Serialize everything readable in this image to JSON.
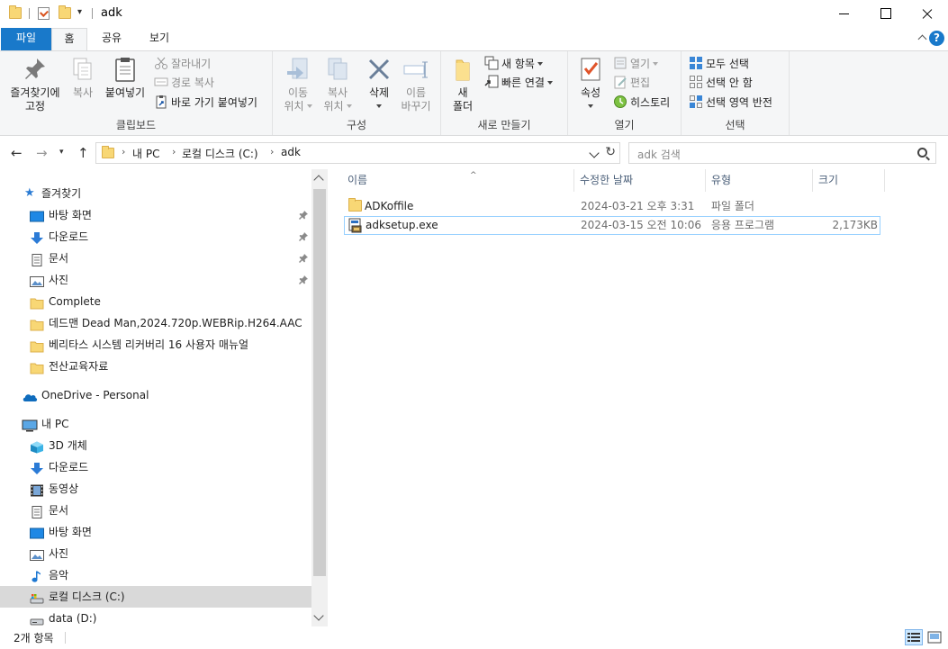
{
  "window": {
    "title": "adk",
    "qa_dropdown": "▾"
  },
  "ribbon_tabs": [
    {
      "label": "파일"
    },
    {
      "label": "홈"
    },
    {
      "label": "공유"
    },
    {
      "label": "보기"
    }
  ],
  "ribbon": {
    "clipboard": {
      "label": "클립보드",
      "pin": "즐겨찾기에\n고정",
      "copy": "복사",
      "paste": "붙여넣기",
      "cut": "잘라내기",
      "copy_path": "경로 복사",
      "paste_shortcut": "바로 가기 붙여넣기"
    },
    "organize": {
      "label": "구성",
      "move_to": "이동\n위치",
      "copy_to": "복사\n위치",
      "delete": "삭제",
      "rename": "이름\n바꾸기"
    },
    "new": {
      "label": "새로 만들기",
      "new_folder": "새\n폴더",
      "new_item": "새 항목",
      "easy_access": "빠른 연결"
    },
    "open": {
      "label": "열기",
      "properties": "속성",
      "open": "열기",
      "edit": "편집",
      "history": "히스토리"
    },
    "select": {
      "label": "선택",
      "select_all": "모두 선택",
      "select_none": "선택 안 함",
      "invert": "선택 영역 반전"
    }
  },
  "address": {
    "crumbs": [
      "내 PC",
      "로컬 디스크 (C:)",
      "adk"
    ],
    "sep": "›",
    "search_placeholder": "adk 검색"
  },
  "nav": {
    "quick_access": "즐겨찾기",
    "items": [
      {
        "label": "바탕 화면",
        "icon": "desktop-icon",
        "pinned": true
      },
      {
        "label": "다운로드",
        "icon": "download-icon",
        "pinned": true
      },
      {
        "label": "문서",
        "icon": "document-icon",
        "pinned": true
      },
      {
        "label": "사진",
        "icon": "pictures-icon",
        "pinned": true
      },
      {
        "label": "Complete",
        "icon": "folder-icon"
      },
      {
        "label": "데드맨 Dead Man,2024.720p.WEBRip.H264.AAC",
        "icon": "folder-icon"
      },
      {
        "label": "베리타스 시스템 리커버리 16 사용자 매뉴얼",
        "icon": "folder-icon"
      },
      {
        "label": "전산교육자료",
        "icon": "folder-icon"
      }
    ],
    "onedrive": "OneDrive - Personal",
    "this_pc": "내 PC",
    "pc_items": [
      {
        "label": "3D 개체",
        "icon": "3d-objects-icon"
      },
      {
        "label": "다운로드",
        "icon": "download-icon"
      },
      {
        "label": "동영상",
        "icon": "videos-icon"
      },
      {
        "label": "문서",
        "icon": "document-icon"
      },
      {
        "label": "바탕 화면",
        "icon": "desktop-icon"
      },
      {
        "label": "사진",
        "icon": "pictures-icon"
      },
      {
        "label": "음악",
        "icon": "music-icon"
      },
      {
        "label": "로컬 디스크 (C:)",
        "icon": "local-disk-icon",
        "selected": true
      },
      {
        "label": "data (D:)",
        "icon": "drive-icon"
      }
    ]
  },
  "columns": {
    "name": "이름",
    "date": "수정한 날짜",
    "type": "유형",
    "size": "크기"
  },
  "files": [
    {
      "name": "ADKoffile",
      "date": "2024-03-21 오후 3:31",
      "type": "파일 폴더",
      "size": "",
      "icon": "folder-icon"
    },
    {
      "name": "adksetup.exe",
      "date": "2024-03-15 오전 10:06",
      "type": "응용 프로그램",
      "size": "2,173KB",
      "icon": "setup-exe-icon"
    }
  ],
  "status": {
    "count": "2개 항목"
  },
  "colors": {
    "accent": "#1979ca",
    "folder": "#f8d775",
    "selected_nav": "#d9d9d9"
  }
}
